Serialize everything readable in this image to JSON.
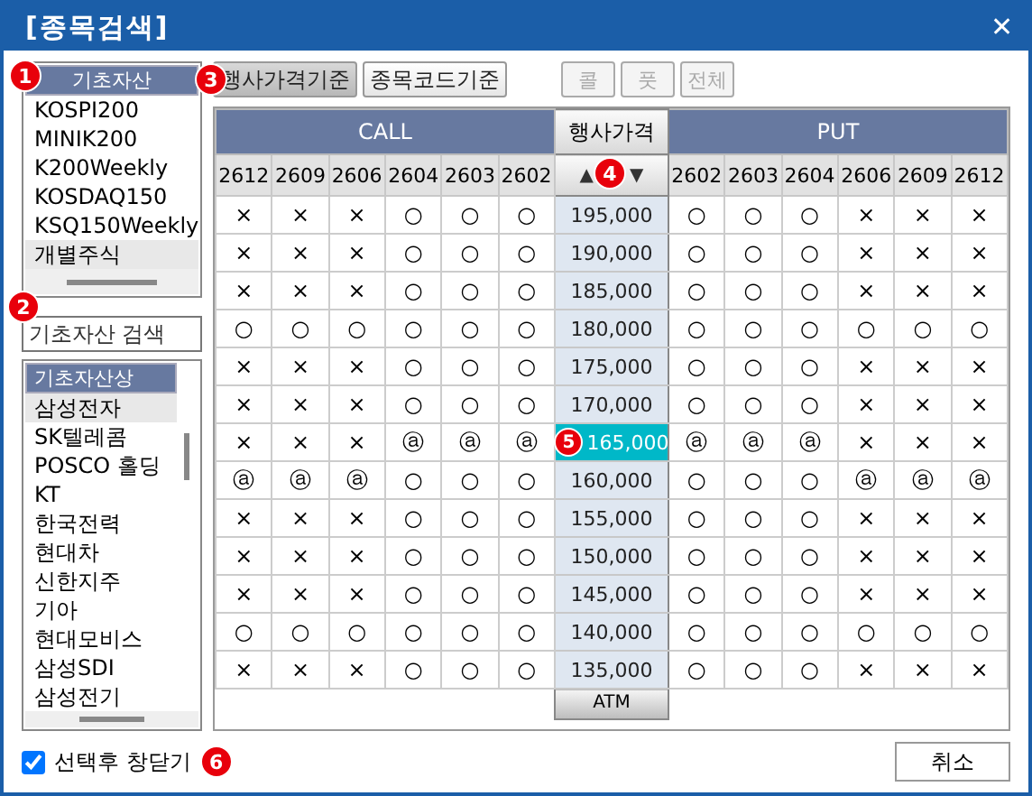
{
  "window": {
    "title": "[종목검색]",
    "close": "✕"
  },
  "underlying_list": {
    "header": "기초자산",
    "marker": "1",
    "items": [
      {
        "label": "KOSPI200",
        "selected": false
      },
      {
        "label": "MINIK200",
        "selected": false
      },
      {
        "label": "K200Weekly",
        "selected": false
      },
      {
        "label": "KOSDAQ150",
        "selected": false
      },
      {
        "label": "KSQ150Weekly",
        "selected": false
      },
      {
        "label": "개별주식",
        "selected": true
      }
    ]
  },
  "search": {
    "placeholder": "기초자산 검색",
    "marker": "2"
  },
  "stock_list": {
    "header": "기초자산상",
    "items": [
      {
        "label": "삼성전자",
        "selected": true
      },
      {
        "label": "SK텔레콤",
        "selected": false
      },
      {
        "label": "POSCO 홀딩",
        "selected": false
      },
      {
        "label": "KT",
        "selected": false
      },
      {
        "label": "한국전력",
        "selected": false
      },
      {
        "label": "현대차",
        "selected": false
      },
      {
        "label": "신한지주",
        "selected": false
      },
      {
        "label": "기아",
        "selected": false
      },
      {
        "label": "현대모비스",
        "selected": false
      },
      {
        "label": "삼성SDI",
        "selected": false
      },
      {
        "label": "삼성전기",
        "selected": false
      }
    ]
  },
  "mode_buttons": [
    {
      "label": "행사가격기준",
      "selected": true,
      "marker": "3"
    },
    {
      "label": "종목코드기준",
      "selected": false
    }
  ],
  "filter_buttons": [
    {
      "label": "콜",
      "disabled": true
    },
    {
      "label": "풋",
      "disabled": true
    },
    {
      "label": "전체",
      "disabled": true
    }
  ],
  "table": {
    "call_title": "CALL",
    "put_title": "PUT",
    "strike_title": "행사가격",
    "sort_up": "▲",
    "sort_down": "▼",
    "sort_marker": "4",
    "call_months": [
      "2612",
      "2609",
      "2606",
      "2604",
      "2603",
      "2602"
    ],
    "put_months": [
      "2602",
      "2603",
      "2604",
      "2606",
      "2609",
      "2612"
    ],
    "rows": [
      {
        "strike": "195,000",
        "selected": false,
        "call": [
          "×",
          "×",
          "×",
          "○",
          "○",
          "○"
        ],
        "put": [
          "○",
          "○",
          "○",
          "×",
          "×",
          "×"
        ]
      },
      {
        "strike": "190,000",
        "selected": false,
        "call": [
          "×",
          "×",
          "×",
          "○",
          "○",
          "○"
        ],
        "put": [
          "○",
          "○",
          "○",
          "×",
          "×",
          "×"
        ]
      },
      {
        "strike": "185,000",
        "selected": false,
        "call": [
          "×",
          "×",
          "×",
          "○",
          "○",
          "○"
        ],
        "put": [
          "○",
          "○",
          "○",
          "×",
          "×",
          "×"
        ]
      },
      {
        "strike": "180,000",
        "selected": false,
        "call": [
          "○",
          "○",
          "○",
          "○",
          "○",
          "○"
        ],
        "put": [
          "○",
          "○",
          "○",
          "○",
          "○",
          "○"
        ]
      },
      {
        "strike": "175,000",
        "selected": false,
        "call": [
          "×",
          "×",
          "×",
          "○",
          "○",
          "○"
        ],
        "put": [
          "○",
          "○",
          "○",
          "×",
          "×",
          "×"
        ]
      },
      {
        "strike": "170,000",
        "selected": false,
        "call": [
          "×",
          "×",
          "×",
          "○",
          "○",
          "○"
        ],
        "put": [
          "○",
          "○",
          "○",
          "×",
          "×",
          "×"
        ]
      },
      {
        "strike": "165,000",
        "selected": true,
        "marker": "5",
        "call": [
          "×",
          "×",
          "×",
          "ⓐ",
          "ⓐ",
          "ⓐ"
        ],
        "put": [
          "ⓐ",
          "ⓐ",
          "ⓐ",
          "×",
          "×",
          "×"
        ]
      },
      {
        "strike": "160,000",
        "selected": false,
        "call": [
          "ⓐ",
          "ⓐ",
          "ⓐ",
          "○",
          "○",
          "○"
        ],
        "put": [
          "○",
          "○",
          "○",
          "ⓐ",
          "ⓐ",
          "ⓐ"
        ]
      },
      {
        "strike": "155,000",
        "selected": false,
        "call": [
          "×",
          "×",
          "×",
          "○",
          "○",
          "○"
        ],
        "put": [
          "○",
          "○",
          "○",
          "×",
          "×",
          "×"
        ]
      },
      {
        "strike": "150,000",
        "selected": false,
        "call": [
          "×",
          "×",
          "×",
          "○",
          "○",
          "○"
        ],
        "put": [
          "○",
          "○",
          "○",
          "×",
          "×",
          "×"
        ]
      },
      {
        "strike": "145,000",
        "selected": false,
        "call": [
          "×",
          "×",
          "×",
          "○",
          "○",
          "○"
        ],
        "put": [
          "○",
          "○",
          "○",
          "×",
          "×",
          "×"
        ]
      },
      {
        "strike": "140,000",
        "selected": false,
        "call": [
          "○",
          "○",
          "○",
          "○",
          "○",
          "○"
        ],
        "put": [
          "○",
          "○",
          "○",
          "○",
          "○",
          "○"
        ]
      },
      {
        "strike": "135,000",
        "selected": false,
        "call": [
          "×",
          "×",
          "×",
          "○",
          "○",
          "○"
        ],
        "put": [
          "○",
          "○",
          "○",
          "×",
          "×",
          "×"
        ]
      }
    ],
    "atm": "ATM"
  },
  "close_option": {
    "label": "선택후 창닫기",
    "checked": true,
    "marker": "6"
  },
  "cancel_button": "취소"
}
